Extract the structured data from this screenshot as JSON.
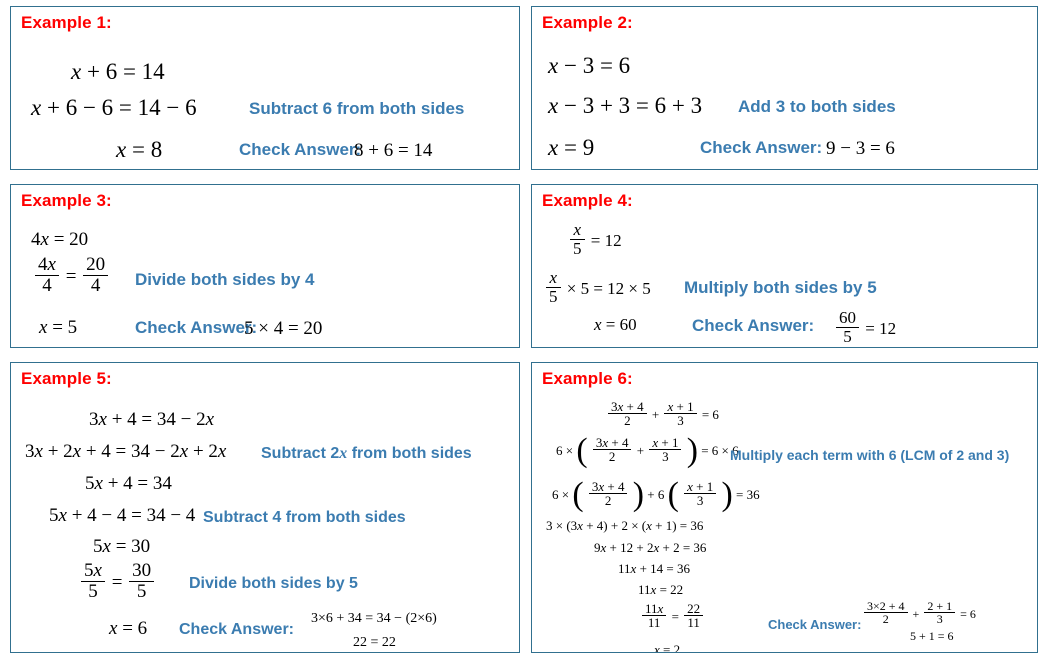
{
  "page": {
    "accent_red": "#FF0000",
    "accent_blue": "#3B7CB0",
    "border_color": "#31708F",
    "background": "#FFFFFF"
  },
  "examples": [
    {
      "title": "Example 1:",
      "equations": [
        "x + 6 = 14",
        "x + 6 − 6 = 14 − 6",
        "x = 8"
      ],
      "notes": [
        "Subtract 6 from both sides"
      ],
      "check_label": "Check Answer:",
      "check": [
        "8 + 6 = 14"
      ]
    },
    {
      "title": "Example 2:",
      "equations": [
        "x − 3 = 6",
        "x − 3 + 3 = 6 + 3",
        "x = 9"
      ],
      "notes": [
        "Add 3 to both sides"
      ],
      "check_label": "Check Answer:",
      "check": [
        "9 − 3 = 6"
      ]
    },
    {
      "title": "Example 3:",
      "equations": [
        "4x = 20",
        "4x/4 = 20/4",
        "x = 5"
      ],
      "notes": [
        "Divide both sides by 4"
      ],
      "check_label": "Check Answer:",
      "check": [
        "5 × 4 = 20"
      ],
      "fractions": [
        {
          "num": "4x",
          "den": "4"
        },
        {
          "num": "20",
          "den": "4"
        }
      ]
    },
    {
      "title": "Example 4:",
      "equations": [
        "x/5 = 12",
        "x/5 × 5 = 12 × 5",
        "x = 60"
      ],
      "notes": [
        "Multiply both sides by 5"
      ],
      "check_label": "Check Answer:",
      "check": [
        "60/5 = 12"
      ],
      "fractions": [
        {
          "num": "x",
          "den": "5"
        },
        {
          "num": "60",
          "den": "5"
        }
      ]
    },
    {
      "title": "Example 5:",
      "equations": [
        "3x + 4 = 34 − 2x",
        "3x + 2x + 4 = 34 − 2x + 2x",
        "5x + 4 = 34",
        "5x + 4 − 4 = 34 − 4",
        "5x = 30",
        "5x/5 = 30/5",
        "x = 6"
      ],
      "notes": [
        "Subtract 2x from both sides",
        "Subtract 4 from both sides",
        "Divide both sides by 5"
      ],
      "check_label": "Check Answer:",
      "check": [
        "3 × 6 + 34 = 34 − (2 × 6)",
        "22 = 22"
      ],
      "fractions": [
        {
          "num": "5x",
          "den": "5"
        },
        {
          "num": "30",
          "den": "5"
        }
      ]
    },
    {
      "title": "Example 6:",
      "equations": [
        "(3x + 4)/2 + (x + 1)/3 = 6",
        "6 × ( (3x + 4)/2 + (x + 1)/3 ) = 6 × 6",
        "6 × ( (3x + 4)/2 ) + 6( (x + 1)/3 ) = 36",
        "3 × (3x + 4) + 2 × (x + 1) = 36",
        "9x + 12 + 2x + 2 = 36",
        "11x + 14 = 36",
        "11x = 22",
        "11x/11 = 22/11",
        "x = 2"
      ],
      "notes": [
        "Multiply each term with 6 (LCM of 2 and 3)"
      ],
      "check_label": "Check Answer:",
      "check": [
        "(3 × 2 + 4)/2 + (2 + 1)/3 = 6",
        "5 + 1 = 6"
      ],
      "fractions": [
        {
          "num": "3x + 4",
          "den": "2"
        },
        {
          "num": "x + 1",
          "den": "3"
        },
        {
          "num": "11x",
          "den": "11"
        },
        {
          "num": "22",
          "den": "11"
        },
        {
          "num": "3×2 + 4",
          "den": "2"
        },
        {
          "num": "2 + 1",
          "den": "3"
        }
      ]
    }
  ],
  "tokens": {
    "x": "x",
    "times": "×",
    "minus": "−",
    "plus": "+",
    "eq": "=",
    "lparen": "(",
    "rparen": ")"
  }
}
